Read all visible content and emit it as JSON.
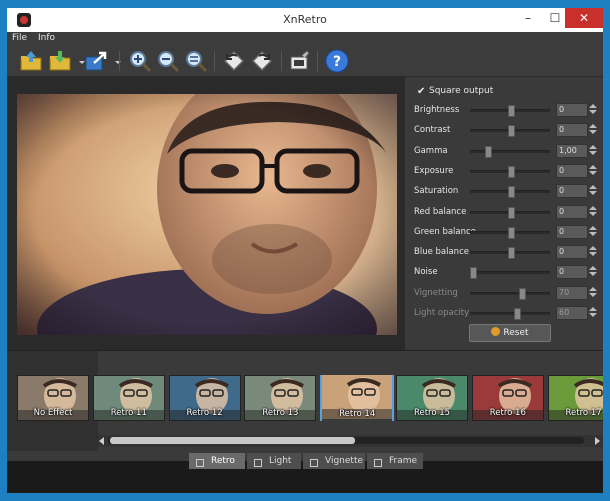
{
  "window": {
    "title": "XnRetro",
    "minimize": "–",
    "maximize": "☐",
    "close": "✕"
  },
  "menu": {
    "file": "File",
    "info": "Info"
  },
  "toolbar": {
    "icons": [
      "open-icon",
      "save-icon",
      "export-icon",
      "zoom-in-icon",
      "zoom-out-icon",
      "zoom-fit-icon",
      "rotate-left-icon",
      "rotate-right-icon",
      "crop-icon",
      "help-icon"
    ],
    "help_glyph": "?"
  },
  "controls": {
    "square_output": {
      "label": "Square output",
      "checked": true,
      "glyph": "✔"
    },
    "sliders": [
      {
        "label": "Brightness",
        "value": "0",
        "level": 0.5,
        "enabled": true
      },
      {
        "label": "Contrast",
        "value": "0",
        "level": 0.5,
        "enabled": true
      },
      {
        "label": "Gamma",
        "value": "1,00",
        "level": 0.2,
        "enabled": true
      },
      {
        "label": "Exposure",
        "value": "0",
        "level": 0.5,
        "enabled": true
      },
      {
        "label": "Saturation",
        "value": "0",
        "level": 0.5,
        "enabled": true
      },
      {
        "label": "Red balance",
        "value": "0",
        "level": 0.5,
        "enabled": true
      },
      {
        "label": "Green balance",
        "value": "0",
        "level": 0.5,
        "enabled": true
      },
      {
        "label": "Blue balance",
        "value": "0",
        "level": 0.5,
        "enabled": true
      },
      {
        "label": "Noise",
        "value": "0",
        "level": 0.0,
        "enabled": true
      },
      {
        "label": "Vignetting",
        "value": "70",
        "level": 0.65,
        "enabled": false
      },
      {
        "label": "Light opacity",
        "value": "60",
        "level": 0.58,
        "enabled": false
      }
    ],
    "reset_label": "Reset"
  },
  "presets": [
    {
      "label": "No Effect",
      "tint": "#8a7a6a",
      "selected": false
    },
    {
      "label": "Retro 11",
      "tint": "#6f8a7a",
      "selected": false
    },
    {
      "label": "Retro 12",
      "tint": "#3f6a8a",
      "selected": false
    },
    {
      "label": "Retro 13",
      "tint": "#7a8a7a",
      "selected": false
    },
    {
      "label": "Retro 14",
      "tint": "#c9a27a",
      "selected": true
    },
    {
      "label": "Retro 15",
      "tint": "#4a8a6a",
      "selected": false
    },
    {
      "label": "Retro 16",
      "tint": "#9a3a3a",
      "selected": false
    },
    {
      "label": "Retro 17",
      "tint": "#6a9a3a",
      "selected": false
    }
  ],
  "tabs": [
    {
      "label": "Retro",
      "icon": "magic-wand-icon",
      "active": true
    },
    {
      "label": "Light",
      "icon": "light-icon",
      "active": false
    },
    {
      "label": "Vignette",
      "icon": "vignette-icon",
      "active": false
    },
    {
      "label": "Frame",
      "icon": "frame-icon",
      "active": false
    }
  ],
  "colors": {
    "selection": "#5aa0e0",
    "close": "#c9302c",
    "panel": "#3c3c3c"
  }
}
